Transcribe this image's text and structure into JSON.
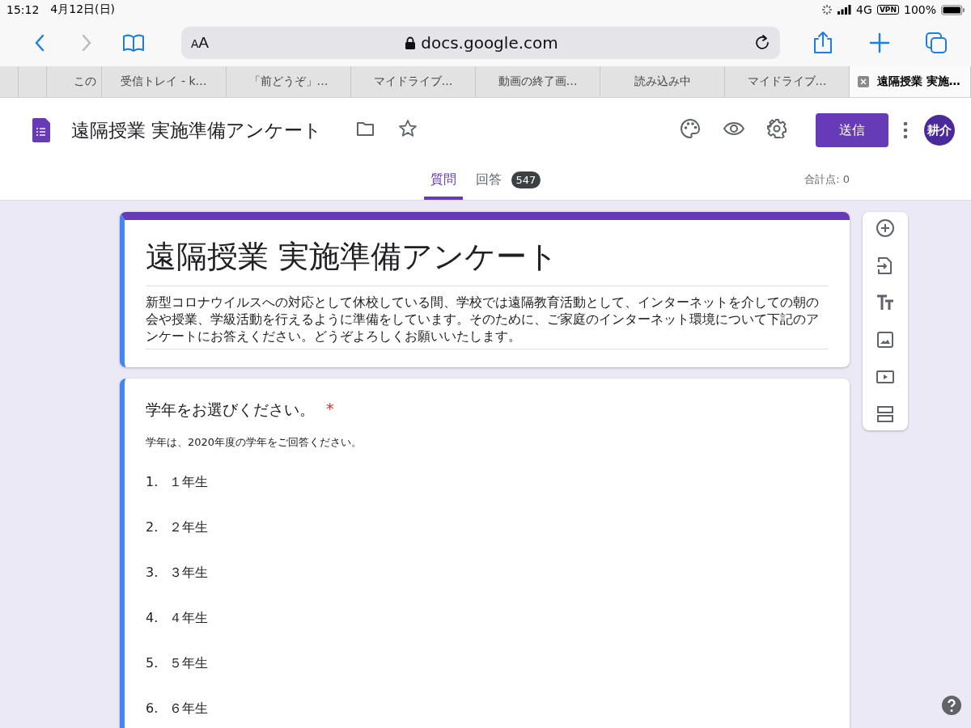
{
  "status_bar": {
    "time": "15:12",
    "date": "4月12日(日)",
    "network": "4G",
    "vpn": "VPN",
    "battery": "100%"
  },
  "browser": {
    "text_size": "AA",
    "url": "docs.google.com",
    "tabs": [
      {
        "label": "この",
        "selected": false
      },
      {
        "label": "受信トレイ - k…",
        "selected": false
      },
      {
        "label": "「前どうぞ」…",
        "selected": false
      },
      {
        "label": "マイドライブ…",
        "selected": false
      },
      {
        "label": "動画の終了画…",
        "selected": false
      },
      {
        "label": "読み込み中",
        "selected": false
      },
      {
        "label": "マイドライブ…",
        "selected": false
      },
      {
        "label": "遠隔授業 実施…",
        "selected": true
      }
    ]
  },
  "header": {
    "title": "遠隔授業 実施準備アンケート",
    "send_button": "送信",
    "avatar": "耕介"
  },
  "nav_tabs": [
    {
      "label": "質問",
      "selected": true
    },
    {
      "label": "回答",
      "selected": false,
      "badge": "547"
    }
  ],
  "total_points": "合計点: 0",
  "form": {
    "title": "遠隔授業 実施準備アンケート",
    "description": "新型コロナウイルスへの対応として休校している間、学校では遠隔教育活動として、インターネットを介しての朝の会や授業、学級活動を行えるように準備をしています。そのために、ご家庭のインターネット環境について下記のアンケートにお答えください。どうぞよろしくお願いいたします。"
  },
  "question": {
    "title": "学年をお選びください。",
    "required": true,
    "required_mark": "*",
    "help": "学年は、2020年度の学年をご回答ください。",
    "options": [
      {
        "number": "1.",
        "label": "１年生"
      },
      {
        "number": "2.",
        "label": "２年生"
      },
      {
        "number": "3.",
        "label": "３年生"
      },
      {
        "number": "4.",
        "label": "４年生"
      },
      {
        "number": "5.",
        "label": "５年生"
      },
      {
        "number": "6.",
        "label": "６年生"
      }
    ]
  }
}
